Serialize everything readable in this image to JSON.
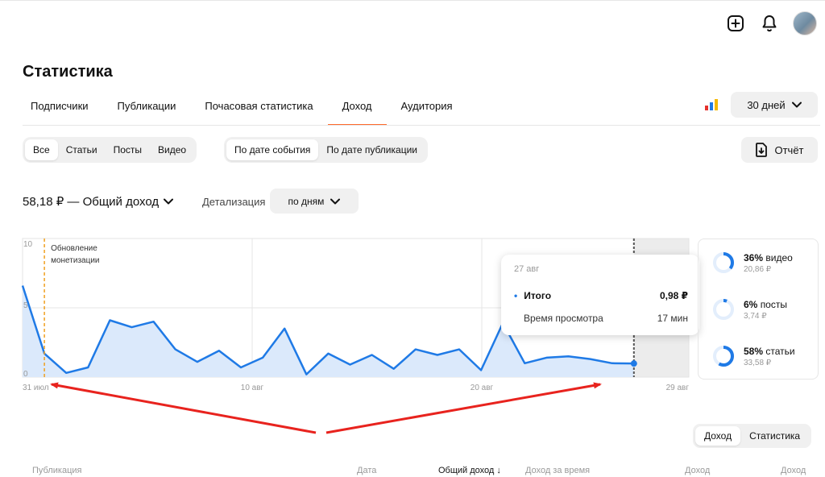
{
  "header": {
    "icons": [
      "add-icon",
      "bell-icon",
      "avatar"
    ]
  },
  "page_title": "Статистика",
  "tabs": [
    {
      "label": "Подписчики"
    },
    {
      "label": "Публикации"
    },
    {
      "label": "Почасовая статистика"
    },
    {
      "label": "Доход",
      "active": true
    },
    {
      "label": "Аудитория"
    }
  ],
  "period": {
    "label": "30 дней"
  },
  "content_filter": [
    {
      "label": "Все",
      "active": true
    },
    {
      "label": "Статьи"
    },
    {
      "label": "Посты"
    },
    {
      "label": "Видео"
    }
  ],
  "date_filter": [
    {
      "label": "По дате события",
      "active": true
    },
    {
      "label": "По дате публикации"
    }
  ],
  "report_button": {
    "label": "Отчёт"
  },
  "income": {
    "title": "58,18 ₽ — Общий доход",
    "detail_label": "Детализация",
    "detail_value": "по дням"
  },
  "colors": {
    "accent_tab": "#ff6a2b",
    "line": "#1f7ae6",
    "area": "#dbe9fb",
    "annotation": "#f0a020"
  },
  "chart_data": {
    "type": "area",
    "x_start_label": "31 июл",
    "tick_labels": [
      "31 июл",
      "10 авг",
      "20 авг",
      "29 авг"
    ],
    "y_ticks": [
      "0",
      "5",
      "10"
    ],
    "ylim": [
      0,
      10
    ],
    "values": [
      6.6,
      1.7,
      0.3,
      0.7,
      4.1,
      3.6,
      4.0,
      2.0,
      1.1,
      1.9,
      0.7,
      1.4,
      3.5,
      0.2,
      1.7,
      0.9,
      1.6,
      0.6,
      2.0,
      1.6,
      2.0,
      0.5,
      3.9,
      1.0,
      1.4,
      1.5,
      1.3,
      1.0,
      0.98
    ],
    "highlight_index": 28,
    "annotation": {
      "text_line1": "Обновление",
      "text_line2": "монетизации",
      "index": 1
    }
  },
  "tooltip": {
    "date": "27 авг",
    "total_label": "Итого",
    "total_value": "0,98 ₽",
    "watch_label": "Время просмотра",
    "watch_value": "17 мин"
  },
  "breakdown": [
    {
      "pct": "36%",
      "name": "видео",
      "sum": "20,86 ₽",
      "frac": 0.36
    },
    {
      "pct": "6%",
      "name": "посты",
      "sum": "3,74 ₽",
      "frac": 0.06
    },
    {
      "pct": "58%",
      "name": "статьи",
      "sum": "33,58 ₽",
      "frac": 0.58
    }
  ],
  "table_toggle": [
    {
      "label": "Доход",
      "active": true
    },
    {
      "label": "Статистика"
    }
  ],
  "table_headers": {
    "publication": "Публикация",
    "date": "Дата",
    "total_income": "Общий доход ↓",
    "income_time": "Доход за время",
    "income1": "Доход",
    "income2": "Доход"
  }
}
